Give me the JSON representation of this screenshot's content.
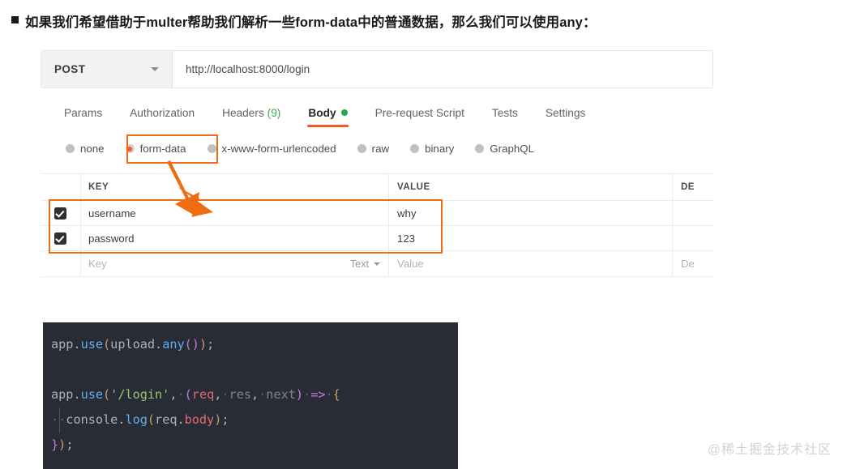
{
  "heading": {
    "text": "如果我们希望借助于multer帮助我们解析一些form-data中的普通数据，那么我们可以使用any："
  },
  "postman": {
    "request": {
      "method": "POST",
      "method_caret": "chevron-down-icon",
      "url": "http://localhost:8000/login"
    },
    "tabs": [
      {
        "label": "Params",
        "active": false
      },
      {
        "label": "Authorization",
        "active": false
      },
      {
        "label": "Headers",
        "count": "(9)",
        "active": false
      },
      {
        "label": "Body",
        "active": true,
        "indicator": "green-dot"
      },
      {
        "label": "Pre-request Script",
        "active": false
      },
      {
        "label": "Tests",
        "active": false
      },
      {
        "label": "Settings",
        "active": false
      }
    ],
    "body_types": [
      {
        "label": "none",
        "selected": false
      },
      {
        "label": "form-data",
        "selected": true
      },
      {
        "label": "x-www-form-urlencoded",
        "selected": false
      },
      {
        "label": "raw",
        "selected": false
      },
      {
        "label": "binary",
        "selected": false
      },
      {
        "label": "GraphQL",
        "selected": false
      }
    ],
    "table": {
      "headers": {
        "key": "KEY",
        "value": "VALUE",
        "description": "DE"
      },
      "rows": [
        {
          "checked": true,
          "key": "username",
          "value": "why",
          "description": ""
        },
        {
          "checked": true,
          "key": "password",
          "value": "123",
          "description": ""
        }
      ],
      "placeholder_row": {
        "key": "Key",
        "type": "Text",
        "type_caret": "chevron-down-icon",
        "value": "Value",
        "description": "De"
      }
    },
    "annotations": {
      "highlight_color": "#ef6c12",
      "arrow": "orange-arrow-pointing-to-table"
    }
  },
  "code": {
    "lines": [
      [
        {
          "t": "app.",
          "c": "plain"
        },
        {
          "t": "use",
          "c": "fn"
        },
        {
          "t": "(",
          "c": "paren1"
        },
        {
          "t": "upload.",
          "c": "plain"
        },
        {
          "t": "any",
          "c": "fn"
        },
        {
          "t": "(",
          "c": "paren2"
        },
        {
          "t": ")",
          "c": "paren2"
        },
        {
          "t": ")",
          "c": "paren1"
        },
        {
          "t": ";",
          "c": "plain"
        }
      ],
      [],
      [
        {
          "t": "app.",
          "c": "plain"
        },
        {
          "t": "use",
          "c": "fn"
        },
        {
          "t": "(",
          "c": "paren1"
        },
        {
          "t": "'/login'",
          "c": "str"
        },
        {
          "t": ",",
          "c": "plain"
        },
        {
          "t": "·",
          "c": "mid"
        },
        {
          "t": "(",
          "c": "paren2"
        },
        {
          "t": "req",
          "c": "prop"
        },
        {
          "t": ",",
          "c": "plain"
        },
        {
          "t": "·",
          "c": "mid"
        },
        {
          "t": "res",
          "c": "dim"
        },
        {
          "t": ",",
          "c": "plain"
        },
        {
          "t": "·",
          "c": "mid"
        },
        {
          "t": "next",
          "c": "dim"
        },
        {
          "t": ")",
          "c": "paren2"
        },
        {
          "t": "·",
          "c": "mid"
        },
        {
          "t": "=>",
          "c": "arrow"
        },
        {
          "t": "·",
          "c": "mid"
        },
        {
          "t": "{",
          "c": "paren1"
        }
      ],
      [
        {
          "t": "··",
          "c": "mid"
        },
        {
          "t": "console.",
          "c": "plain"
        },
        {
          "t": "log",
          "c": "fn"
        },
        {
          "t": "(",
          "c": "paren1"
        },
        {
          "t": "req.",
          "c": "plain"
        },
        {
          "t": "body",
          "c": "prop"
        },
        {
          "t": ")",
          "c": "paren1"
        },
        {
          "t": ";",
          "c": "plain"
        }
      ],
      [
        {
          "t": "}",
          "c": "paren2"
        },
        {
          "t": ")",
          "c": "paren1"
        },
        {
          "t": ";",
          "c": "plain"
        }
      ]
    ]
  },
  "watermark": {
    "text": "@稀土掘金技术社区"
  }
}
